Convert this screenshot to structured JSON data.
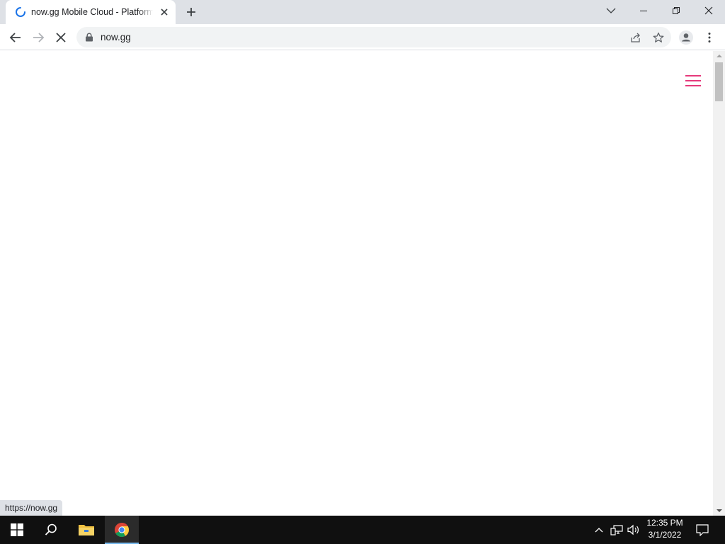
{
  "browser": {
    "tab": {
      "title": "now.gg Mobile Cloud - Platform",
      "favicon": "loading-spinner-icon"
    },
    "window_controls": [
      "tab-search-icon",
      "minimize-icon",
      "restore-icon",
      "close-icon"
    ],
    "toolbar": {
      "back": "back-arrow-icon",
      "forward": "forward-arrow-icon",
      "stop": "stop-loading-icon",
      "url": "now.gg",
      "right_icons": [
        "share-icon",
        "bookmark-star-icon",
        "profile-icon",
        "menu-dots-icon"
      ]
    },
    "status_bar_url": "https://now.gg"
  },
  "page": {
    "menu_icon": "hamburger-menu-icon",
    "accent_color": "#e6397b"
  },
  "taskbar": {
    "apps": [
      "windows-start-icon",
      "search-icon",
      "file-explorer-icon",
      "chrome-icon"
    ],
    "tray": [
      "chevron-up-icon",
      "network-icon",
      "volume-icon"
    ],
    "time": "12:35 PM",
    "date": "3/1/2022",
    "notification": "action-center-icon"
  }
}
